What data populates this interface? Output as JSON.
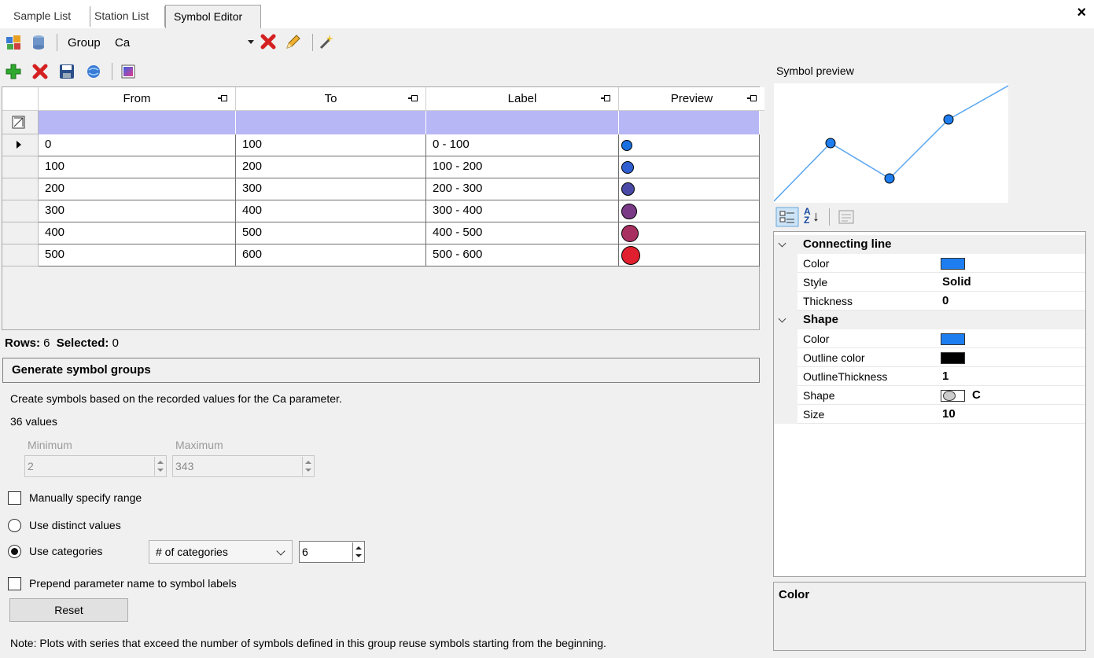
{
  "tabs": [
    {
      "label": "Sample List"
    },
    {
      "label": "Station List"
    },
    {
      "label": "Symbol Editor",
      "active": true
    }
  ],
  "toolbar": {
    "group_label": "Group",
    "group_value": "Ca"
  },
  "grid": {
    "columns": [
      "From",
      "To",
      "Label",
      "Preview"
    ],
    "rows": [
      {
        "from": "0",
        "to": "100",
        "label": "0 - 100",
        "color": "#1a6fe0",
        "size": 14
      },
      {
        "from": "100",
        "to": "200",
        "label": "100 - 200",
        "color": "#2f5fd0",
        "size": 16
      },
      {
        "from": "200",
        "to": "300",
        "label": "200 - 300",
        "color": "#4a4aa6",
        "size": 17
      },
      {
        "from": "300",
        "to": "400",
        "label": "300 - 400",
        "color": "#7a3a86",
        "size": 20
      },
      {
        "from": "400",
        "to": "500",
        "label": "400 - 500",
        "color": "#a83060",
        "size": 22
      },
      {
        "from": "500",
        "to": "600",
        "label": "500 - 600",
        "color": "#e0202e",
        "size": 24
      }
    ]
  },
  "status": {
    "rows_label": "Rows:",
    "rows_value": "6",
    "selected_label": "Selected:",
    "selected_value": "0"
  },
  "generate": {
    "header": "Generate symbol groups",
    "description": "Create symbols based on the recorded values for the Ca parameter.",
    "values_count": "36 values",
    "minimum_label": "Minimum",
    "minimum_value": "2",
    "maximum_label": "Maximum",
    "maximum_value": "343",
    "manual_range_label": "Manually specify range",
    "distinct_label": "Use distinct values",
    "categories_label": "Use categories",
    "categories_mode": "# of categories",
    "categories_count": "6",
    "prepend_label": "Prepend parameter name to symbol labels",
    "reset_label": "Reset",
    "note": "Note: Plots with series that exceed the number of symbols defined in this group reuse symbols starting from the beginning."
  },
  "preview": {
    "label": "Symbol preview",
    "points": [
      [
        0,
        150
      ],
      [
        72,
        76
      ],
      [
        147,
        121
      ],
      [
        222,
        46
      ],
      [
        298,
        3
      ]
    ]
  },
  "properties": {
    "categories": [
      {
        "name": "Connecting line",
        "items": [
          {
            "name": "Color",
            "swatch": "#1e7ef0"
          },
          {
            "name": "Style",
            "value": "Solid"
          },
          {
            "name": "Thickness",
            "value": "0"
          }
        ]
      },
      {
        "name": "Shape",
        "items": [
          {
            "name": "Color",
            "swatch": "#1e7ef0"
          },
          {
            "name": "Outline color",
            "swatch": "#000000"
          },
          {
            "name": "OutlineThickness",
            "value": "1"
          },
          {
            "name": "Shape",
            "value": "C",
            "shape_icon": "circle-shape-icon"
          },
          {
            "name": "Size",
            "value": "10"
          }
        ]
      }
    ]
  },
  "description_box": {
    "title": "Color"
  }
}
